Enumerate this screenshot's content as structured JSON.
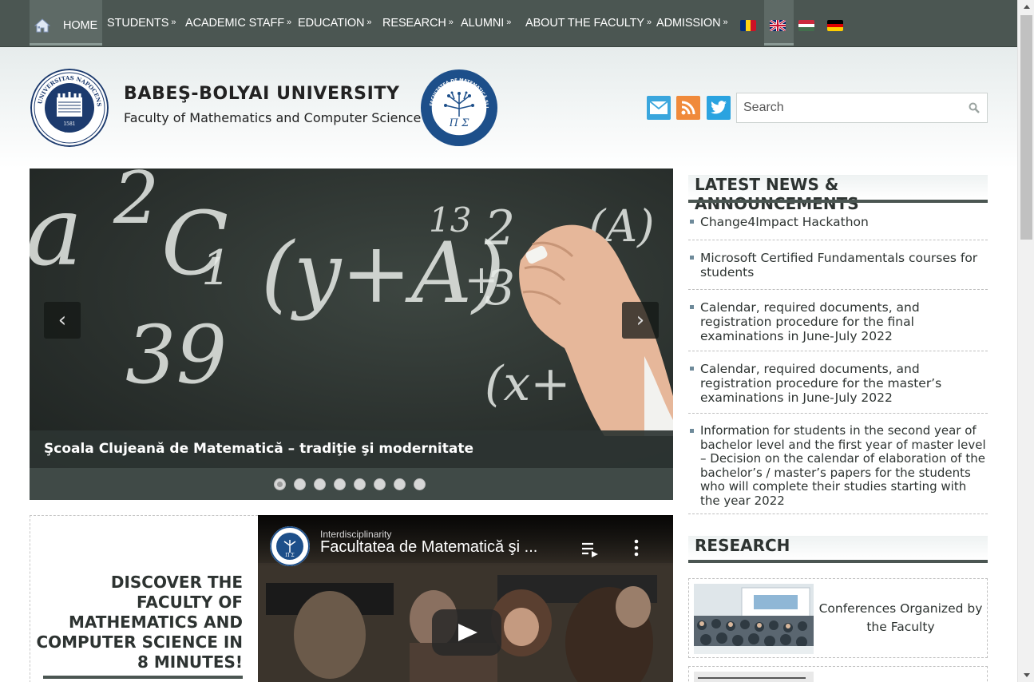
{
  "nav": {
    "items": [
      {
        "label": "HOME"
      },
      {
        "label": "STUDENTS"
      },
      {
        "label": "ACADEMIC STAFF"
      },
      {
        "label": "EDUCATION"
      },
      {
        "label": "RESEARCH"
      },
      {
        "label": "ALUMNI"
      },
      {
        "label": "ABOUT THE FACULTY"
      },
      {
        "label": "ADMISSION"
      }
    ],
    "dropdown_icon": "double-chevron-right-icon",
    "flags": [
      "ro",
      "en",
      "hu",
      "de"
    ],
    "active_language": "en"
  },
  "header": {
    "university": "BABEŞ-BOLYAI UNIVERSITY",
    "faculty": "Faculty of Mathematics and Computer Science",
    "seal_ubb_text": "UNIVERSITAS NAPOCENSIS · BABEŞ-BOLYAI · 1581",
    "seal_fac_text": "FACULTATEA DE MATEMATICĂ ŞI INFORMATICĂ · ROMÂNIA"
  },
  "social": [
    "mail-icon",
    "rss-icon",
    "twitter-icon"
  ],
  "search": {
    "placeholder": "Search"
  },
  "slider": {
    "caption": "Şcoala Clujeană de Matematică – tradiţie şi modernitate",
    "slide_count": 8,
    "active_index": 0,
    "prev": "‹",
    "next": "›"
  },
  "discover": {
    "text": "DISCOVER THE FACULTY OF MATHEMATICS AND COMPUTER SCIENCE IN 8 MINUTES!"
  },
  "video": {
    "title": "Facultatea de Matematică şi ...",
    "channel_sub": "Interdisciplinarity"
  },
  "news": {
    "heading": "LATEST NEWS & ANNOUNCEMENTS",
    "items": [
      "Change4Impact Hackathon",
      "Microsoft Certified Fundamentals courses for students",
      "Calendar, required documents, and registration procedure for the final examinations in June-July 2022",
      "Calendar, required documents, and registration procedure for the master’s examinations in June-July 2022",
      "Information for students in the second year of bachelor level and the first year of master level – Decision on the calendar of elaboration of the bachelor’s / master’s papers for the students who will complete their studies starting with the year 2022"
    ]
  },
  "research": {
    "heading": "RESEARCH",
    "cards": [
      {
        "label": "Conferences Organized by the Faculty"
      }
    ]
  },
  "colors": {
    "nav_bg": "#4b5652",
    "accent_bar": "#4b5652",
    "text": "#2d3331",
    "mail": "#3aa6dd",
    "rss": "#f08a3b",
    "twitter": "#2aa3e0"
  }
}
